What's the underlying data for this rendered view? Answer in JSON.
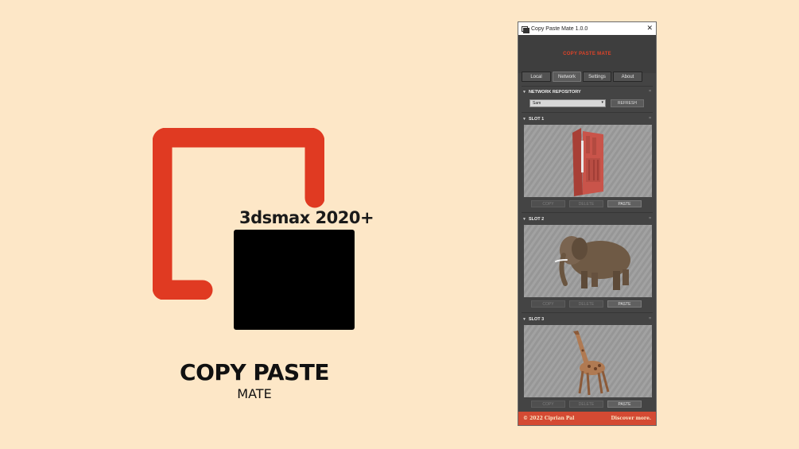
{
  "promo": {
    "version_label": "3dsmax 2020+",
    "title": "COPY PASTE",
    "subtitle": "MATE",
    "accent_color": "#e03a22"
  },
  "window": {
    "title": "Copy Paste Mate 1.0.0",
    "close_glyph": "✕",
    "header_title": "COPY PASTE MATE",
    "tabs": [
      {
        "label": "Local"
      },
      {
        "label": "Network"
      },
      {
        "label": "Settings"
      },
      {
        "label": "About"
      }
    ],
    "active_tab": "Network",
    "repository": {
      "heading": "NETWORK REPOSITORY",
      "selected_value": "Sam",
      "refresh_label": "REFRESH"
    },
    "slots": [
      {
        "heading": "SLOT 1",
        "preview": "red-door-icon",
        "copy_label": "COPY",
        "delete_label": "DELETE",
        "paste_label": "PASTE"
      },
      {
        "heading": "SLOT 2",
        "preview": "elephant-icon",
        "copy_label": "COPY",
        "delete_label": "DELETE",
        "paste_label": "PASTE"
      },
      {
        "heading": "SLOT 3",
        "preview": "giraffe-icon",
        "copy_label": "COPY",
        "delete_label": "DELETE",
        "paste_label": "PASTE"
      }
    ],
    "footer": {
      "copyright": "© 2022 Ciprian Pal",
      "link": "Discover more."
    },
    "colors": {
      "accent": "#e04328",
      "footer": "#d44a33",
      "panel": "#444444"
    }
  }
}
